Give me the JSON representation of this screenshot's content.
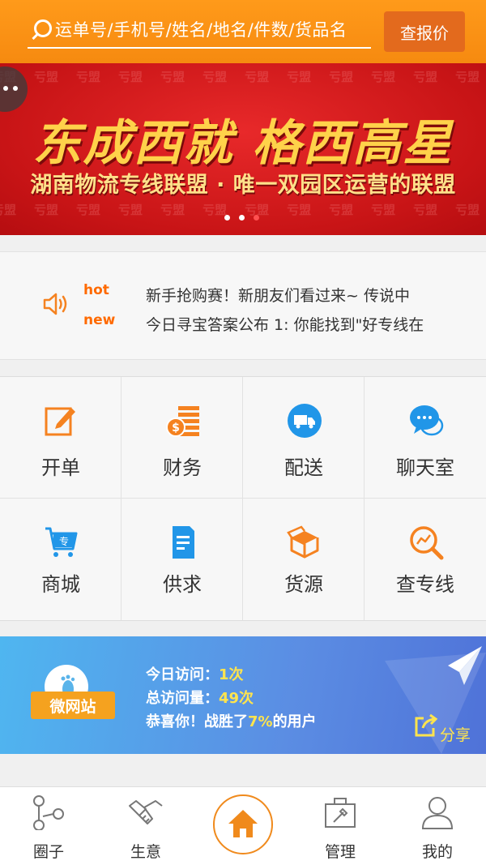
{
  "header": {
    "search_placeholder": "运单号/手机号/姓名/地名/件数/货品名",
    "quote_button": "查报价"
  },
  "banner": {
    "watermark": "亏盟",
    "title": "东成西就  格西高星",
    "subtitle": "湖南物流专线联盟 · 唯一双园区运营的联盟"
  },
  "notice": {
    "hot_tag": "hot",
    "new_tag": "new",
    "items": [
      "新手抢购赛！新朋友们看过来~  传说中",
      "今日寻宝答案公布 1:  你能找到\"好专线在"
    ]
  },
  "grid": {
    "items": [
      {
        "label": "开单",
        "icon": "edit-icon"
      },
      {
        "label": "财务",
        "icon": "finance-icon"
      },
      {
        "label": "配送",
        "icon": "truck-icon"
      },
      {
        "label": "聊天室",
        "icon": "chat-icon"
      },
      {
        "label": "商城",
        "icon": "cart-icon"
      },
      {
        "label": "供求",
        "icon": "document-icon"
      },
      {
        "label": "货源",
        "icon": "box-icon"
      },
      {
        "label": "查专线",
        "icon": "search-line-icon"
      }
    ]
  },
  "micro_site": {
    "ribbon": "微网站",
    "visit_today_label": "今日访问：",
    "visit_today_value": "1次",
    "visit_total_label": "总访问量：",
    "visit_total_value": "49次",
    "beat_prefix": "恭喜你！战胜了",
    "beat_value": "7%",
    "beat_suffix": "的用户",
    "share": "分享"
  },
  "tabbar": {
    "items": [
      {
        "label": "圈子",
        "icon": "circle-network-icon"
      },
      {
        "label": "生意",
        "icon": "handshake-icon"
      },
      {
        "label": "",
        "icon": "home-icon"
      },
      {
        "label": "管理",
        "icon": "toolbox-icon"
      },
      {
        "label": "我的",
        "icon": "user-icon"
      }
    ]
  },
  "colors": {
    "primary": "#f68a10",
    "banner_red": "#c81416",
    "icon_orange": "#f58220",
    "icon_blue": "#2196e8",
    "micro_blue": "#5b8de3"
  }
}
